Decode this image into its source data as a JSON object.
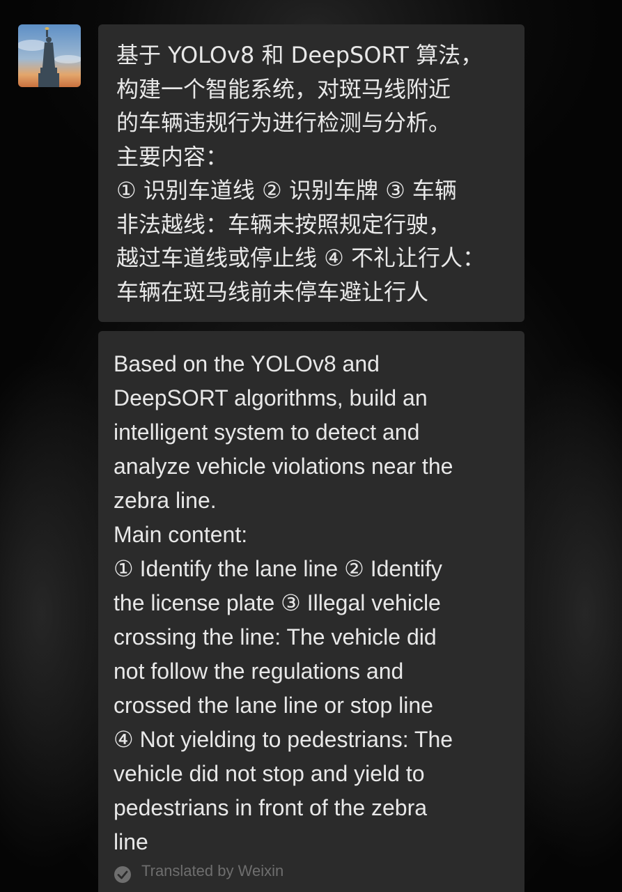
{
  "chat": {
    "avatar_icon": "statue-of-liberty-avatar",
    "original_message": {
      "lines": [
        "基于 YOLOv8 和 DeepSORT 算法，",
        "构建一个智能系统，对斑马线附近",
        "的车辆违规行为进行检测与分析。",
        "主要内容：",
        "① 识别车道线 ② 识别车牌 ③ 车辆",
        "非法越线：车辆未按照规定行驶，",
        "越过车道线或停止线 ④ 不礼让行人：",
        "车辆在斑马线前未停车避让行人"
      ]
    },
    "translated_message": {
      "lines": [
        "Based on the YOLOv8 and",
        "DeepSORT algorithms, build an",
        "intelligent system to detect and",
        "analyze vehicle violations near the",
        "zebra line.",
        "Main content:",
        "① Identify the lane line ② Identify",
        "the license plate ③ Illegal vehicle",
        "crossing the line: The vehicle did",
        "not follow the regulations and",
        "crossed the lane line or stop line",
        "④ Not yielding to pedestrians: The",
        "vehicle did not stop and yield to",
        "pedestrians in front of the zebra",
        "line"
      ],
      "footer_icon": "check-circle-icon",
      "footer_text": "Translated by Weixin"
    }
  },
  "colors": {
    "bubble_bg": "#2b2b2b",
    "text": "#e8e8e8",
    "footer_text": "#6e6e6e",
    "background": "#050505"
  }
}
